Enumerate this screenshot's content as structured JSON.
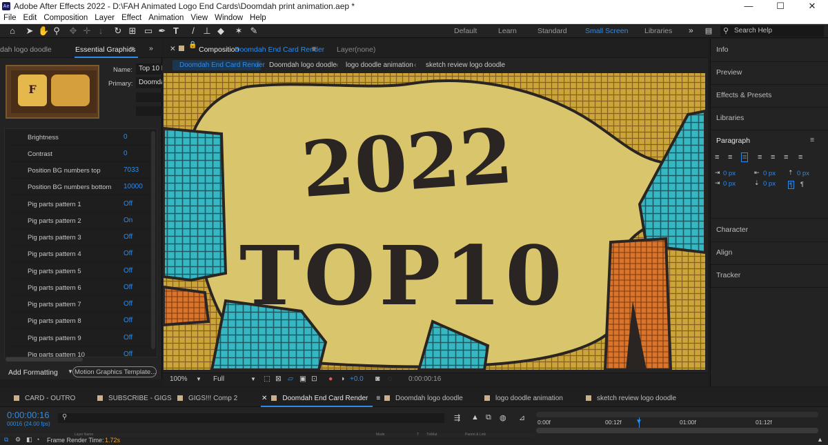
{
  "app": {
    "title": "Adobe After Effects 2022 - D:\\FAH Animated Logo End Cards\\Doomdah print animation.aep *",
    "icon_label": "Ae",
    "window_buttons": [
      "—",
      "☐",
      "✕"
    ]
  },
  "menu": [
    "File",
    "Edit",
    "Composition",
    "Layer",
    "Effect",
    "Animation",
    "View",
    "Window",
    "Help"
  ],
  "workspaces": {
    "items": [
      {
        "label": "Default",
        "active": false
      },
      {
        "label": "Learn",
        "active": false
      },
      {
        "label": "Standard",
        "active": false
      },
      {
        "label": "Small Screen",
        "active": true
      },
      {
        "label": "Libraries",
        "active": false
      }
    ],
    "overflow": "»",
    "search_placeholder": "Search Help"
  },
  "left_panel": {
    "tab_partial": "dah logo doodle",
    "tab_active": "Essential Graphics",
    "name_label": "Name:",
    "name_value": "Top 10 L",
    "primary_label": "Primary:",
    "primary_value": "Doomda",
    "properties": [
      {
        "name": "Brightness",
        "value": "0"
      },
      {
        "name": "Contrast",
        "value": "0"
      },
      {
        "name": "Position BG numbers top",
        "value": "7033"
      },
      {
        "name": "Position BG numbers bottom",
        "value": "10000"
      },
      {
        "name": "Pig parts pattern 1",
        "value": "Off"
      },
      {
        "name": "Pig parts pattern 2",
        "value": "On"
      },
      {
        "name": "Pig parts pattern 3",
        "value": "Off"
      },
      {
        "name": "Pig parts pattern 4",
        "value": "Off"
      },
      {
        "name": "Pig parts pattern 5",
        "value": "Off"
      },
      {
        "name": "Pig parts pattern 6",
        "value": "Off"
      },
      {
        "name": "Pig parts pattern 7",
        "value": "Off"
      },
      {
        "name": "Pig parts pattern 8",
        "value": "Off"
      },
      {
        "name": "Pig parts pattern 9",
        "value": "Off"
      },
      {
        "name": "Pig parts pattern 10",
        "value": "Off"
      }
    ],
    "add_formatting": "Add Formatting",
    "mgt_button": "Motion Graphics Template..."
  },
  "composition": {
    "tab_prefix": "Composition",
    "tab_name": "Doomdah End Card Render",
    "layer_label": "Layer",
    "layer_value": "(none)",
    "breadcrumbs": [
      "Doomdah End Card Render",
      "Doomdah logo doodle",
      "logo doodle animation",
      "sketch review logo doodle"
    ],
    "artwork_text_top": "2022",
    "artwork_text_bottom": "TOP10",
    "zoom": "100%",
    "resolution": "Full",
    "exposure": "+0.0",
    "timecode": "0:00:00:16"
  },
  "right_panel": {
    "items_top": [
      "Info",
      "Preview",
      "Effects & Presets",
      "Libraries"
    ],
    "paragraph_title": "Paragraph",
    "indent_values": [
      "0 px",
      "0 px",
      "0 px",
      "0 px",
      "0 px"
    ],
    "items_bottom": [
      "Character",
      "Align",
      "Tracker"
    ]
  },
  "timeline": {
    "tabs": [
      {
        "label": "CARD - OUTRO",
        "active": false,
        "closable": false
      },
      {
        "label": "SUBSCRIBE - GIGS",
        "active": false,
        "closable": false
      },
      {
        "label": "GIGS!!! Comp 2",
        "active": false,
        "closable": false
      },
      {
        "label": "Doomdah End Card Render",
        "active": true,
        "closable": true
      },
      {
        "label": "Doomdah logo doodle",
        "active": false,
        "closable": false
      },
      {
        "label": "logo doodle animation",
        "active": false,
        "closable": false
      },
      {
        "label": "sketch review logo doodle",
        "active": false,
        "closable": false
      }
    ],
    "current_time": "0:00:00:16",
    "frame_info": "00016 (24.00 fps)",
    "ruler_labels": [
      "0:00f",
      "00:12f",
      "01:00f",
      "01:12f"
    ],
    "column_headers": [
      "Layer Name",
      "Mode",
      "T",
      "TrkMat",
      "Parent & Link"
    ],
    "frame_render_label": "Frame Render Time:",
    "frame_render_value": "1.72s"
  },
  "colors": {
    "accent": "#2d8ceb",
    "panel_bg": "#232323",
    "app_bg": "#1d1d1d",
    "art_yellow": "#dcc66a",
    "art_teal": "#37b7c2",
    "art_orange": "#d9742a",
    "art_ink": "#2a2522"
  },
  "icons": [
    "home-icon",
    "selection-arrow-icon",
    "hand-icon",
    "zoom-icon",
    "rotate-icon",
    "rectangle-icon",
    "pen-icon",
    "type-icon",
    "brush-icon",
    "clone-stamp-icon",
    "eraser-icon",
    "puppet-icon",
    "pin-icon",
    "search-icon",
    "snapshot-icon",
    "menu-icon"
  ]
}
